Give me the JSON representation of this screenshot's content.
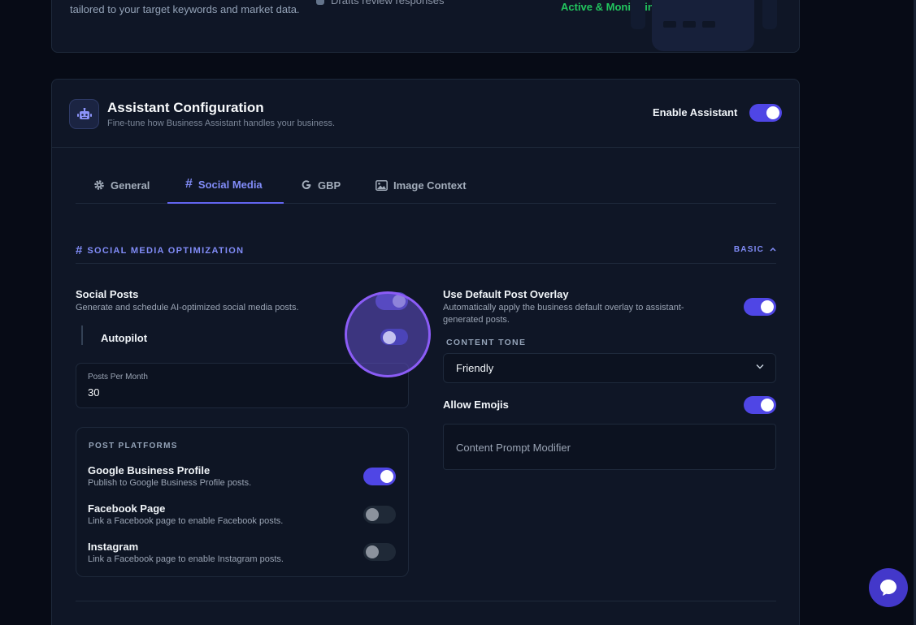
{
  "top_card": {
    "description": "tailored to your target keywords and market data.",
    "drafts_text": "Drafts review responses",
    "status_text": "Active & Monitoring"
  },
  "config": {
    "title": "Assistant Configuration",
    "subtitle": "Fine-tune how Business Assistant handles your business.",
    "enable_label": "Enable Assistant",
    "enable_on": true
  },
  "tabs": [
    {
      "label": "General",
      "icon": "gear-icon",
      "active": false
    },
    {
      "label": "Social Media",
      "icon": "hash-icon",
      "active": true
    },
    {
      "label": "GBP",
      "icon": "google-icon",
      "active": false
    },
    {
      "label": "Image Context",
      "icon": "image-icon",
      "active": false
    }
  ],
  "section": {
    "title": "SOCIAL MEDIA OPTIMIZATION",
    "mode_label": "BASIC"
  },
  "social_posts": {
    "label": "Social Posts",
    "description": "Generate and schedule AI-optimized social media posts.",
    "enabled": true
  },
  "autopilot": {
    "label": "Autopilot",
    "enabled": false
  },
  "posts_per_month": {
    "label": "Posts Per Month",
    "value": "30"
  },
  "platforms": {
    "title": "POST PLATFORMS",
    "items": [
      {
        "name": "Google Business Profile",
        "description": "Publish to Google Business Profile posts.",
        "enabled": true
      },
      {
        "name": "Facebook Page",
        "description": "Link a Facebook page to enable Facebook posts.",
        "enabled": false
      },
      {
        "name": "Instagram",
        "description": "Link a Facebook page to enable Instagram posts.",
        "enabled": false
      }
    ]
  },
  "overlay": {
    "label": "Use Default Post Overlay",
    "description": "Automatically apply the business default overlay to assistant-generated posts.",
    "enabled": true
  },
  "content_tone": {
    "label": "CONTENT TONE",
    "selected": "Friendly"
  },
  "emojis": {
    "label": "Allow Emojis",
    "enabled": true
  },
  "prompt_modifier": {
    "placeholder": "Content Prompt Modifier"
  },
  "colors": {
    "accent": "#6366f1",
    "status_green": "#22c55e",
    "background": "#070b16",
    "card": "#0f1626"
  }
}
